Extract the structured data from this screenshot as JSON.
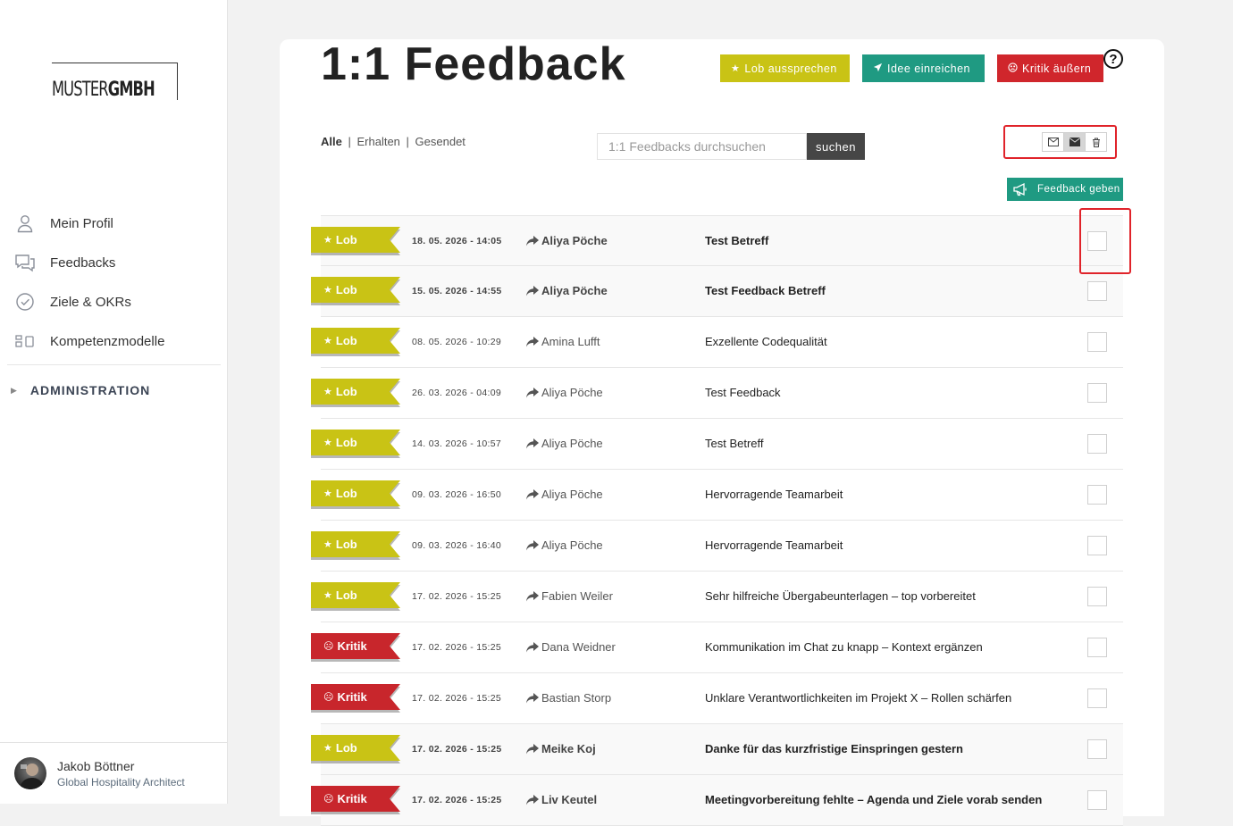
{
  "brand": {
    "logo_light": "MUSTER",
    "logo_bold": "GMBH"
  },
  "sidebar": {
    "items": [
      {
        "label": "Mein Profil",
        "icon": "user-icon"
      },
      {
        "label": "Feedbacks",
        "icon": "chat-icon"
      },
      {
        "label": "Ziele & OKRs",
        "icon": "check-circle-icon"
      },
      {
        "label": "Kompetenzmodelle",
        "icon": "blocks-icon"
      }
    ],
    "admin_label": "ADMINISTRATION",
    "user": {
      "name": "Jakob Böttner",
      "role": "Global Hospitality Architect"
    }
  },
  "header": {
    "title": "1:1 Feedback",
    "buttons": {
      "lob": "Lob aussprechen",
      "idee": "Idee einreichen",
      "kritik": "Kritik äußern"
    },
    "help": "?"
  },
  "filters": {
    "alle": "Alle",
    "erhalten": "Erhalten",
    "gesendet": "Gesendet",
    "separator": "|"
  },
  "search": {
    "placeholder": "1:1 Feedbacks durchsuchen",
    "button": "suchen"
  },
  "feedback_button": "Feedback geben",
  "colors": {
    "lob": "#c9c315",
    "idee": "#1f9a82",
    "kritik": "#d0262c",
    "highlight": "#e0232a"
  },
  "rows": [
    {
      "type": "Lob",
      "date": "18. 05. 2026 - 14:05",
      "person": "Aliya Pöche",
      "subject": "Test Betreff",
      "unread": true
    },
    {
      "type": "Lob",
      "date": "15. 05. 2026 - 14:55",
      "person": "Aliya Pöche",
      "subject": "Test Feedback Betreff",
      "unread": true
    },
    {
      "type": "Lob",
      "date": "08. 05. 2026 - 10:29",
      "person": "Amina Lufft",
      "subject": "Exzellente Codequalität",
      "unread": false
    },
    {
      "type": "Lob",
      "date": "26. 03. 2026 - 04:09",
      "person": "Aliya Pöche",
      "subject": "Test Feedback",
      "unread": false
    },
    {
      "type": "Lob",
      "date": "14. 03. 2026 - 10:57",
      "person": "Aliya Pöche",
      "subject": "Test Betreff",
      "unread": false
    },
    {
      "type": "Lob",
      "date": "09. 03. 2026 - 16:50",
      "person": "Aliya Pöche",
      "subject": "Hervorragende Teamarbeit",
      "unread": false
    },
    {
      "type": "Lob",
      "date": "09. 03. 2026 - 16:40",
      "person": "Aliya Pöche",
      "subject": "Hervorragende Teamarbeit",
      "unread": false
    },
    {
      "type": "Lob",
      "date": "17. 02. 2026 - 15:25",
      "person": "Fabien Weiler",
      "subject": "Sehr hilfreiche Übergabeunterlagen – top vorbereitet",
      "unread": false
    },
    {
      "type": "Kritik",
      "date": "17. 02. 2026 - 15:25",
      "person": "Dana Weidner",
      "subject": "Kommunikation im Chat zu knapp – Kontext ergänzen",
      "unread": false
    },
    {
      "type": "Kritik",
      "date": "17. 02. 2026 - 15:25",
      "person": "Bastian Storp",
      "subject": "Unklare Verantwortlichkeiten im Projekt X – Rollen schärfen",
      "unread": false
    },
    {
      "type": "Lob",
      "date": "17. 02. 2026 - 15:25",
      "person": "Meike Koj",
      "subject": "Danke für das kurzfristige Einspringen gestern",
      "unread": true
    },
    {
      "type": "Kritik",
      "date": "17. 02. 2026 - 15:25",
      "person": "Liv Keutel",
      "subject": "Meetingvorbereitung fehlte – Agenda und Ziele vorab senden",
      "unread": true
    }
  ]
}
